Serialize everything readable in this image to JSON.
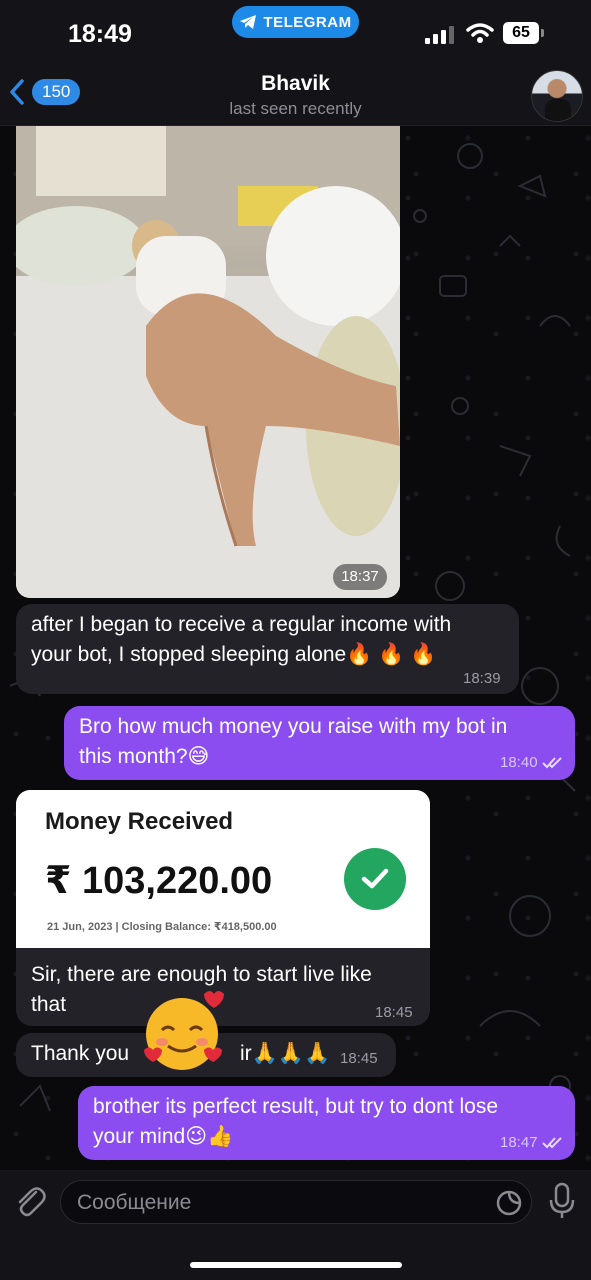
{
  "status_bar": {
    "time": "18:49",
    "app_pill": "TELEGRAM",
    "battery": "65"
  },
  "header": {
    "back_count": "150",
    "contact_name": "Bhavik",
    "contact_status": "last seen recently"
  },
  "messages": [
    {
      "type": "photo",
      "time": "18:37"
    },
    {
      "type": "incoming",
      "text_line1": "after I began to receive a regular income with",
      "text_line2": "your bot, I stopped sleeping alone🔥 🔥 🔥",
      "time": "18:39"
    },
    {
      "type": "outgoing",
      "text_line1": "Bro how much money you raise with my bot in",
      "text_line2": "this month?😅",
      "time": "18:40"
    },
    {
      "type": "incoming_card",
      "card": {
        "title": "Money Received",
        "amount": "₹ 103,220.00",
        "footer": "21 Jun, 2023 | Closing Balance: ₹418,500.00"
      },
      "text_line1": "Sir, there are enough to start live like",
      "text_line2": "that",
      "time": "18:45"
    },
    {
      "type": "incoming",
      "text_a": "Thank you",
      "text_b": "ir🙏🙏🙏",
      "time": "18:45"
    },
    {
      "type": "outgoing",
      "text_line1": "brother its perfect result, but try to dont lose",
      "text_line2": "your mind😉👍",
      "time": "18:47"
    }
  ],
  "input": {
    "placeholder": "Сообщение"
  },
  "colors": {
    "outgoing_bubble": "#8b4cf0",
    "incoming_bubble": "#242229",
    "accent": "#2f8ae6",
    "check_green": "#23a760"
  },
  "icons": [
    "telegram-icon",
    "signal-icon",
    "wifi-icon",
    "back-chevron-icon",
    "paperclip-icon",
    "sticker-icon",
    "microphone-icon",
    "double-check-icon",
    "check-icon"
  ]
}
